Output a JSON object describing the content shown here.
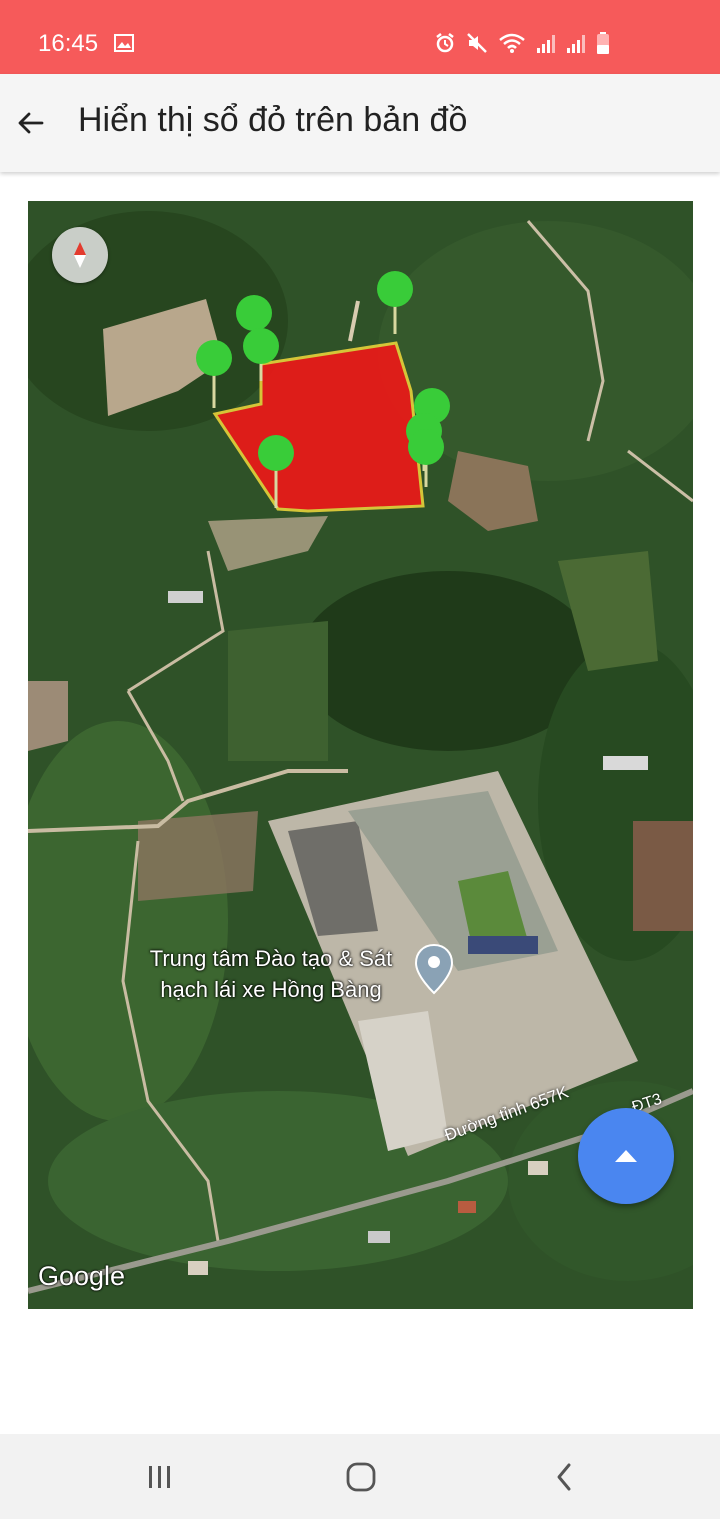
{
  "status_bar": {
    "time": "16:45",
    "icons": [
      "gallery-icon",
      "alarm-icon",
      "mute-icon",
      "wifi-icon",
      "signal-icon",
      "signal-icon",
      "battery-icon"
    ]
  },
  "app_bar": {
    "title": "Hiển thị sổ đỏ trên bản đồ",
    "back_icon": "arrow-left-icon"
  },
  "map": {
    "place_label": "Trung tâm Đào tạo & Sát hạch lái xe Hồng Bàng",
    "road_label": "Đường tỉnh 657K",
    "road_code": "ĐT3",
    "attribution": "Google",
    "parcel_color": "#f01818",
    "parcel_border": "#e8d23a",
    "marker_color": "#39cc39",
    "marker_count": 9
  },
  "fab": {
    "icon": "arrow-up-icon",
    "color": "#4a86f0"
  },
  "nav_bar": {
    "items": [
      "recent-apps-icon",
      "home-icon",
      "back-icon"
    ]
  }
}
